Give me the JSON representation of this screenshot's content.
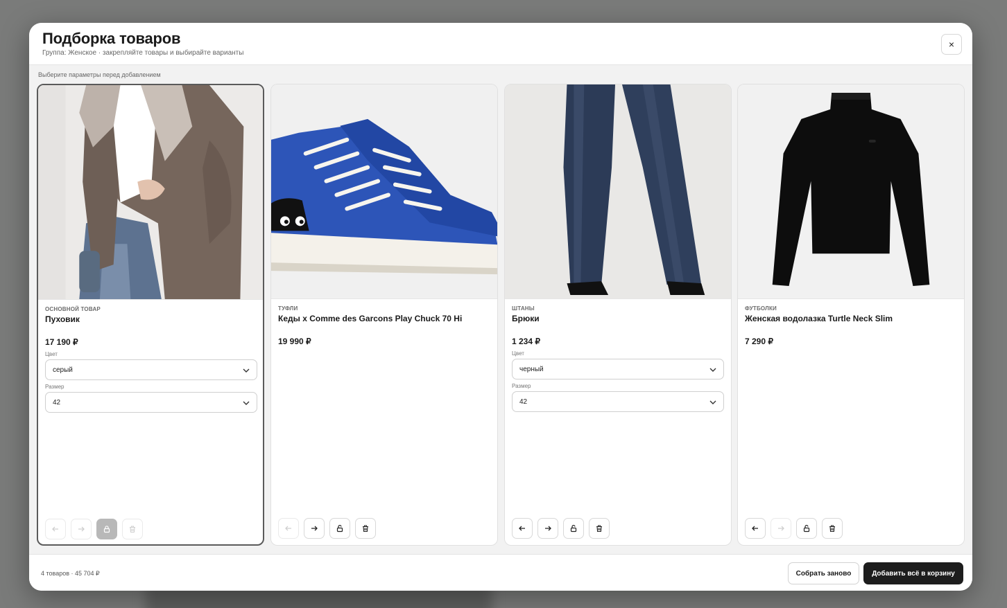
{
  "modal": {
    "title": "Подборка товаров",
    "subtitle": "Группа: Женское · закрепляйте товары и выбирайте варианты",
    "close_icon": "×",
    "hint": "Выберите параметры перед добавлением"
  },
  "products": [
    {
      "category": "ОСНОВНОЙ ТОВАР",
      "name": "Пуховик",
      "price": "17 190 ₽",
      "image": "puffer-jacket-photo",
      "color_label": "Цвет",
      "color_value": "серый",
      "size_label": "Размер",
      "size_value": "42"
    },
    {
      "category": "ТУФЛИ",
      "name": "Кеды x Comme des Garcons Play Chuck 70 Hi",
      "price": "19 990 ₽",
      "image": "blue-sneakers-photo"
    },
    {
      "category": "ШТАНЫ",
      "name": "Брюки",
      "price": "1 234 ₽",
      "image": "wide-trousers-photo",
      "color_label": "Цвет",
      "color_value": "черный",
      "size_label": "Размер",
      "size_value": "42"
    },
    {
      "category": "ФУТБОЛКИ",
      "name": "Женская водолазка Turtle Neck Slim",
      "price": "7 290 ₽",
      "image": "black-turtleneck-photo"
    }
  ],
  "footer": {
    "summary": "4 товаров · 45 704 ₽",
    "rebuild_label": "Собрать заново",
    "add_all_label": "Добавить всё в корзину"
  }
}
